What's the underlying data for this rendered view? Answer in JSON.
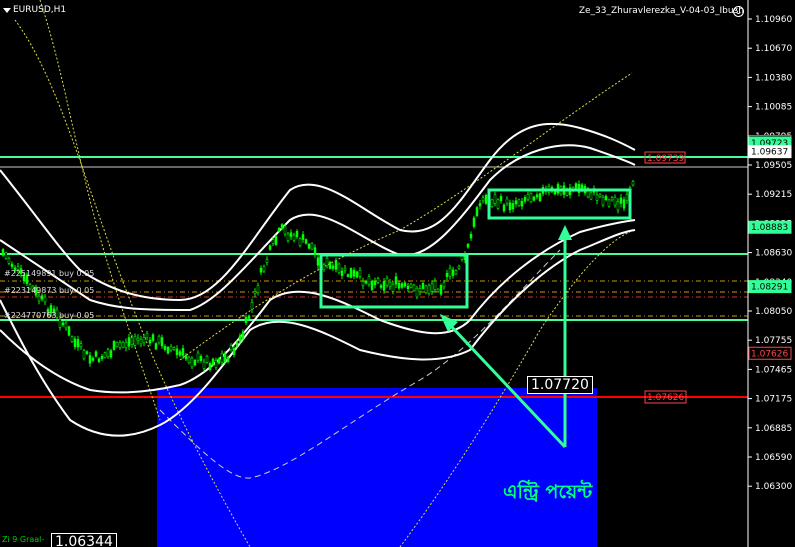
{
  "header": {
    "symbol": "EURUSD,H1",
    "ea_name": "Ze_33_Zhuravlerezka_V-04-03_Ibush",
    "menu_icon": "triangle-down-icon",
    "smiley_icon": "smiley-face-icon"
  },
  "price_axis": {
    "ticks": [
      "1.10960",
      "1.10670",
      "1.10380",
      "1.10085",
      "1.09795",
      "1.09505",
      "1.09215",
      "1.08925",
      "1.08630",
      "1.08340",
      "1.08050",
      "1.07755",
      "1.07465",
      "1.07175",
      "1.06885",
      "1.06590",
      "1.06300"
    ],
    "markers": [
      {
        "label": "1.09739",
        "style": "red-outline",
        "price": 1.09739
      },
      {
        "label": "1.09723",
        "style": "green",
        "price": 1.09723
      },
      {
        "label": "1.09637",
        "style": "white",
        "price": 1.09637
      },
      {
        "label": "1.08883",
        "style": "green",
        "price": 1.08883
      },
      {
        "label": "1.08291",
        "style": "green",
        "price": 1.08291
      },
      {
        "label": "1.07626",
        "style": "red-outline",
        "price": 1.07626
      }
    ]
  },
  "chart_labels": {
    "trade_1": "#225149891 buy 0.05",
    "trade_2": "#223149873 buy 0.05",
    "trade_3": "#224770763 buy 0.05",
    "current_price": "1.07720",
    "bottom_price": "1.06344",
    "indicator": "Zi 9 Graal-",
    "annotation": "এন্ট্রি পয়েন্ট"
  },
  "colors": {
    "background": "#000000",
    "candles": "#00ff00",
    "bands": "#ffffff",
    "horizontal_lines": "#33ff99",
    "stop_line": "#ff0000",
    "zone": "#0000ff",
    "annotation": "#00ff80",
    "ma": "#ffff66"
  }
}
